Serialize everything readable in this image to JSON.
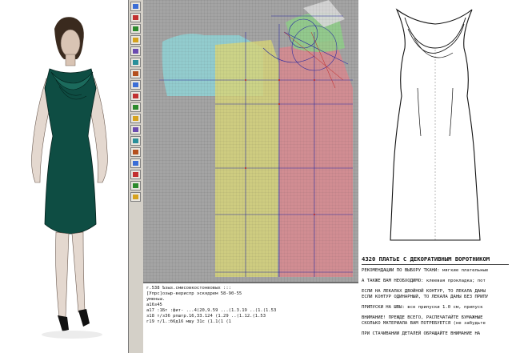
{
  "console": {
    "lines": [
      "г.538 Ъзыз.смисовкостонвовых :::",
      "[Упрс]озыр-вериспр эскядрем 58-90-55",
      "",
      "  уменьш.",
      "",
      "а16з45",
      "а17 :1Бт :фит- ...4(20,9.59 ...(1.3.19 ..(1.(1.53",
      "з18 т/з36 рпштр.16,33.124 (1.29 ..(1.12.(1.53",
      "г19 т/1.:б6д16 мшу 31с (1.1(1 (1"
    ]
  },
  "spec": {
    "title": "4320 ПЛАТЬЕ С ДЕКОРАТИВНЫМ ВОРОТНИКОМ",
    "lines": [
      "РЕКОМЕНДАЦИИ ПО ВЫБОРУ ТКАНИ: мягкие плательные",
      "",
      "А ТАКЖЕ ВАМ НЕОБХОДИМО: клеевая прокладка; пот",
      "",
      "ЕСЛИ НА ЛЕКАЛАХ ДВОЙНОЙ КОНТУР, ТО ЛЕКАЛА ДАНЫ",
      "ЕСЛИ КОНТУР ОДИНАРНЫЙ, ТО ЛЕКАЛА ДАНЫ БЕЗ ПРИПУ",
      "",
      "ПРИПУСКИ НА ШВЫ: все припуски 1.0 см, припуск",
      "",
      "ВНИМАНИЕ! ПРЕЖДЕ ВСЕГО, РАСПЕЧАТАЙТЕ БУМАЖНЫЕ",
      "СКОЛЬКО МАТЕРИАЛА ВАМ ПОТРЕБУЕТСЯ (не забудьте",
      "",
      "ПРИ СТАЧИВАНИИ ДЕТАЛЕЙ ОБРАЩАЙТЕ ВНИМАНИЕ НА"
    ]
  },
  "colors": {
    "dress": "#0e4d43",
    "cyan_piece": "#8fd3d6",
    "yellow_piece": "#d6d47a",
    "pink_piece": "#d98a8f",
    "green_piece": "#8fd08a",
    "pattern_line": "#2a2aa0"
  }
}
